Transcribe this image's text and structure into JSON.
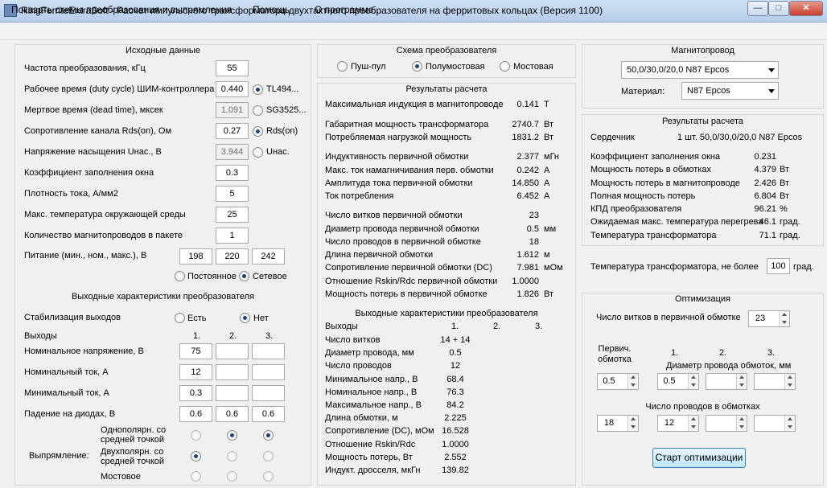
{
  "window": {
    "title": "RingFerriteExtraSoft - Расчет импульсного трансформатора двухтактного преобразователя на ферритовых кольцах (Версия 1100)"
  },
  "menu": [
    "Показать схемы преобразования и выпрямления",
    "Помощь",
    "О программе..."
  ],
  "input": {
    "title": "Исходные данные",
    "freq_label": "Частота преобразования, кГц",
    "freq": "55",
    "duty_label": "Рабочее время (duty cycle) ШИМ-контроллера",
    "duty": "0.440",
    "duty_radio": "TL494...",
    "dead_label": "Мертвое время (dead time), мксек",
    "dead": "1.091",
    "dead_radio": "SG3525...",
    "rds_label": "Сопротивление канала Rds(on), Ом",
    "rds": "0.27",
    "rds_radio": "Rds(on)",
    "usat_label": "Напряжение насыщения Uнас., В",
    "usat": "3.944",
    "usat_radio": "Uнас.",
    "fill_label": "Коэффициент заполнения окна",
    "fill": "0.3",
    "jd_label": "Плотность тока, А/мм2",
    "jd": "5",
    "temp_label": "Макс. температура окружающей среды",
    "temp": "25",
    "cores_label": "Количество магнитопроводов  в пакете",
    "cores": "1",
    "supply_label": "Питание (мин., ном., макс.), В",
    "supply": [
      "198",
      "220",
      "242"
    ],
    "dc_label": "Постоянное",
    "ac_label": "Сетевое"
  },
  "outputs": {
    "title": "Выходные характеристики преобразователя",
    "stab_label": "Стабилизация выходов",
    "stab_yes": "Есть",
    "stab_no": "Нет",
    "outs_label": "Выходы",
    "cols": [
      "1.",
      "2.",
      "3."
    ],
    "unom_label": "Номинальное напряжение, В",
    "unom": [
      "75",
      "",
      ""
    ],
    "inom_label": "Номинальный ток, А",
    "inom": [
      "12",
      "",
      ""
    ],
    "imin_label": "Минимальный ток, А",
    "imin": [
      "0.3",
      "",
      ""
    ],
    "drop_label": "Падение на диодах, В",
    "drop": [
      "0.6",
      "0.6",
      "0.6"
    ],
    "rect_label": "Выпрямление:",
    "rect_a": "Однополярн. со средней точкой",
    "rect_b": "Двухполярн. со средней точкой",
    "rect_c": "Мостовое"
  },
  "scheme": {
    "title": "Схема преобразователя",
    "push_pull": "Пуш-пул",
    "half_bridge": "Полумостовая",
    "bridge": "Мостовая"
  },
  "results": {
    "title": "Результаты расчета",
    "rows": [
      {
        "label": "Максимальная индукция в магнитопроводе",
        "value": "0.141",
        "unit": "Т"
      },
      {
        "label": "Габаритная мощность трансформатора",
        "value": "2740.7",
        "unit": "Вт"
      },
      {
        "label": "Потребляемая нагрузкой мощность",
        "value": "1831.2",
        "unit": "Вт"
      },
      {
        "label": "Индуктивность первичной обмотки",
        "value": "2.377",
        "unit": "мГн"
      },
      {
        "label": "Макс. ток намагничивания перв. обмотки",
        "value": "0.242",
        "unit": "А"
      },
      {
        "label": "Амплитуда тока первичной обмотки",
        "value": "14.850",
        "unit": "А"
      },
      {
        "label": "Ток потребления",
        "value": "6.452",
        "unit": "А"
      },
      {
        "label": "Число витков первичной обмотки",
        "value": "23",
        "unit": ""
      },
      {
        "label": "Диаметр провода первичной обмотки",
        "value": "0.5",
        "unit": "мм"
      },
      {
        "label": "Число проводов в первичной обмотке",
        "value": "18",
        "unit": ""
      },
      {
        "label": "Длина  первичной обмотки",
        "value": "1.612",
        "unit": "м"
      },
      {
        "label": "Сопротивление первичной обмотки (DC)",
        "value": "7.981",
        "unit": "мОм"
      },
      {
        "label": "Отношение Rskin/Rdc первичной обмотки",
        "value": "1.0000",
        "unit": ""
      },
      {
        "label": "Мощность потерь в первичной обмотке",
        "value": "1.826",
        "unit": "Вт"
      }
    ],
    "out_title": "Выходные характеристики преобразователя",
    "out_head": {
      "label": "Выходы",
      "c1": "1.",
      "c2": "2.",
      "c3": "3."
    },
    "out_rows": [
      {
        "label": "Число витков",
        "v": "14 + 14"
      },
      {
        "label": "Диаметр провода, мм",
        "v": "0.5"
      },
      {
        "label": "Число проводов",
        "v": "12"
      },
      {
        "label": "Минимальное напр., В",
        "v": "68.4"
      },
      {
        "label": "Номинальное напр., В",
        "v": "76.3"
      },
      {
        "label": "Максимальное напр., В",
        "v": "84.2"
      },
      {
        "label": "Длина обмотки, м",
        "v": "2.225"
      },
      {
        "label": "Сопротивление (DC), мОм",
        "v": "16.528"
      },
      {
        "label": "Отношение Rskin/Rdc",
        "v": "1.0000"
      },
      {
        "label": "Мощность потерь, Вт",
        "v": "2.552"
      },
      {
        "label": "Индукт. дросселя, мкГн",
        "v": "139.82"
      }
    ]
  },
  "core": {
    "title": "Магнитопровод",
    "selected": "50,0/30,0/20,0 N87 Epcos",
    "material_label": "Материал:",
    "material": "N87 Epcos"
  },
  "core_results": {
    "title": "Результаты расчета",
    "core_label": "Сердечник",
    "core_value": "1 шт. 50,0/30,0/20,0 N87 Epcos",
    "rows": [
      {
        "label": "Коэффициент заполнения окна",
        "value": "0.231",
        "unit": ""
      },
      {
        "label": "Мощность потерь в обмотках",
        "value": "4.379",
        "unit": "Вт"
      },
      {
        "label": "Мощность потерь в магнитопроводе",
        "value": "2.426",
        "unit": "Вт"
      },
      {
        "label": "Полная мощность потерь",
        "value": "6.804",
        "unit": "Вт"
      },
      {
        "label": "КПД преобразователя",
        "value": "96.21",
        "unit": "%"
      },
      {
        "label": "Ожидаемая макс. температура перегрева",
        "value": "46.1",
        "unit": "град."
      },
      {
        "label": "Температура трансформатора",
        "value": "71.1",
        "unit": "град."
      }
    ]
  },
  "tmax": {
    "label": "Температура трансформатора, не более",
    "value": "100",
    "unit": "град."
  },
  "optim": {
    "title": "Оптимизация",
    "turns_label": "Число витков в первичной обмотке",
    "turns": "23",
    "prim_label": "Первич.",
    "prim_label2": "обмотка",
    "cols": [
      "1.",
      "2.",
      "3."
    ],
    "diam_label": "Диаметр провода обмоток, мм",
    "diam": [
      "0.5",
      "0.5",
      "",
      ""
    ],
    "wires_label": "Число проводов в обмотках",
    "wires": [
      "18",
      "12",
      "",
      ""
    ],
    "start": "Старт оптимизации"
  }
}
